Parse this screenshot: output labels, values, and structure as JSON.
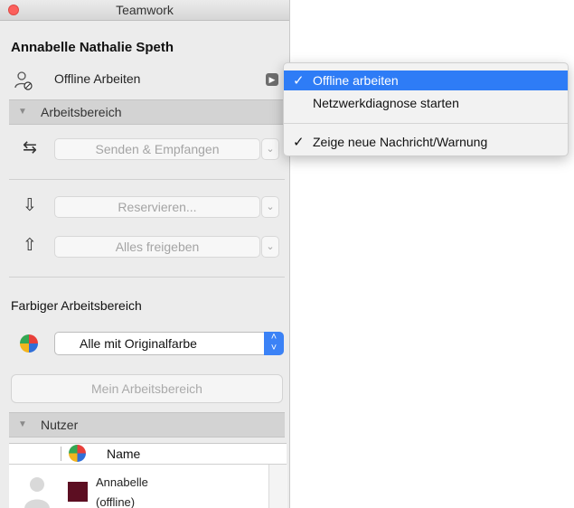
{
  "window": {
    "title": "Teamwork"
  },
  "user": {
    "name": "Annabelle Nathalie Speth"
  },
  "status": {
    "label": "Offline Arbeiten"
  },
  "workspace_section": {
    "header": "Arbeitsbereich",
    "send_receive_label": "Senden & Empfangen",
    "reserve_label": "Reservieren...",
    "release_all_label": "Alles freigeben"
  },
  "color_section": {
    "label": "Farbiger Arbeitsbereich",
    "selected_option": "Alle mit Originalfarbe",
    "my_workspace_button": "Mein Arbeitsbereich"
  },
  "users_section": {
    "header": "Nutzer",
    "columns": [
      "Name"
    ],
    "rows": [
      {
        "name": "Annabelle",
        "status": "(offline)",
        "color": "#5c0e22"
      }
    ]
  },
  "popup_menu": {
    "items": [
      {
        "label": "Offline arbeiten",
        "checked": true,
        "highlighted": true
      },
      {
        "label": "Netzwerkdiagnose starten",
        "checked": false
      },
      {
        "label": "Zeige neue Nachricht/Warnung",
        "checked": true
      }
    ]
  },
  "icons": {
    "status": "user-offline-icon",
    "send_receive": "send-receive-arrows-icon",
    "reserve": "reserve-down-arrow-icon",
    "release": "release-up-arrow-icon",
    "color_wheel": "color-wheel-icon",
    "avatar": "user-avatar-icon"
  },
  "colors": {
    "accent": "#2e7cf6",
    "close": "#fc605c",
    "user_color": "#5c0e22"
  }
}
